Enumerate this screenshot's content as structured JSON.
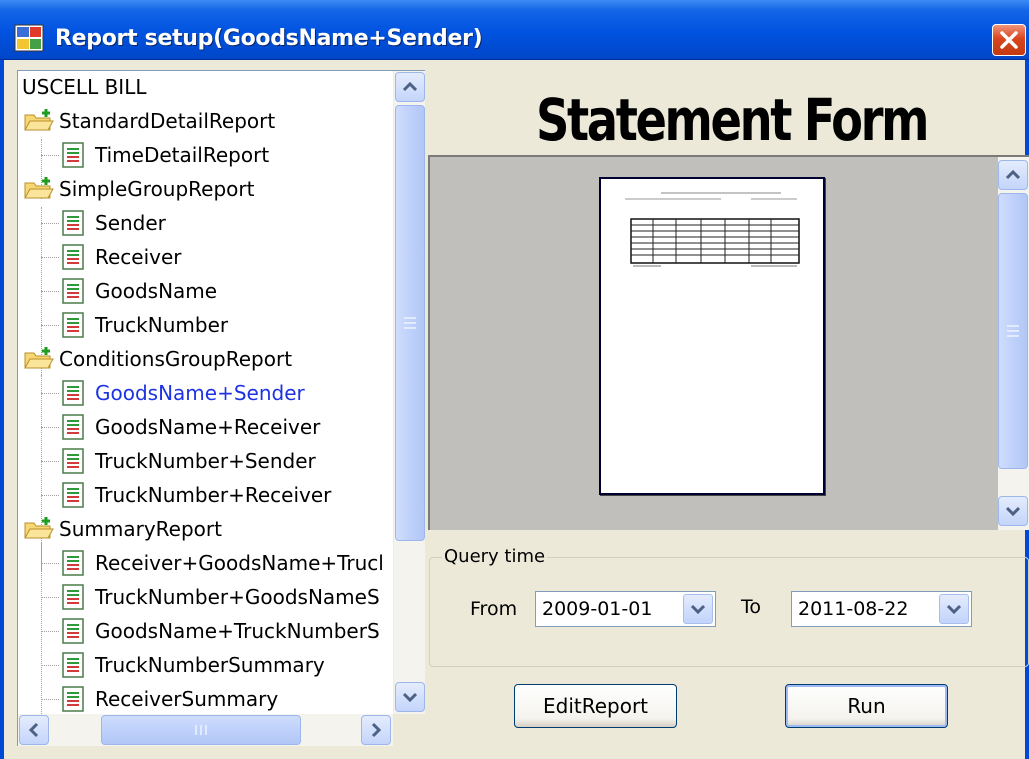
{
  "window": {
    "title": "Report setup(GoodsName+Sender)"
  },
  "tree": {
    "root_label": "USCELL BILL",
    "groups": [
      {
        "label": "StandardDetailReport",
        "items": [
          "TimeDetailReport"
        ]
      },
      {
        "label": "SimpleGroupReport",
        "items": [
          "Sender",
          "Receiver",
          "GoodsName",
          "TruckNumber"
        ]
      },
      {
        "label": "ConditionsGroupReport",
        "items": [
          "GoodsName+Sender",
          "GoodsName+Receiver",
          "TruckNumber+Sender",
          "TruckNumber+Receiver"
        ]
      },
      {
        "label": "SummaryReport",
        "items": [
          "Receiver+GoodsName+Trucl",
          "TruckNumber+GoodsNameS",
          "GoodsName+TruckNumberS",
          "TruckNumberSummary",
          "ReceiverSummary"
        ]
      }
    ],
    "selected_item": "GoodsName+Sender"
  },
  "banner": {
    "text": "Statement Form"
  },
  "query": {
    "group_title": "Query time",
    "from_label": "From",
    "from_value": "2009-01-01",
    "to_label": "To",
    "to_value": "2011-08-22"
  },
  "buttons": {
    "edit_report": "EditReport",
    "run": "Run"
  },
  "colors": {
    "title_bar": "#0053e0",
    "selected_text": "#1d33e3",
    "window_bg": "#ece9d8",
    "preview_bg": "#c0bfbc"
  }
}
